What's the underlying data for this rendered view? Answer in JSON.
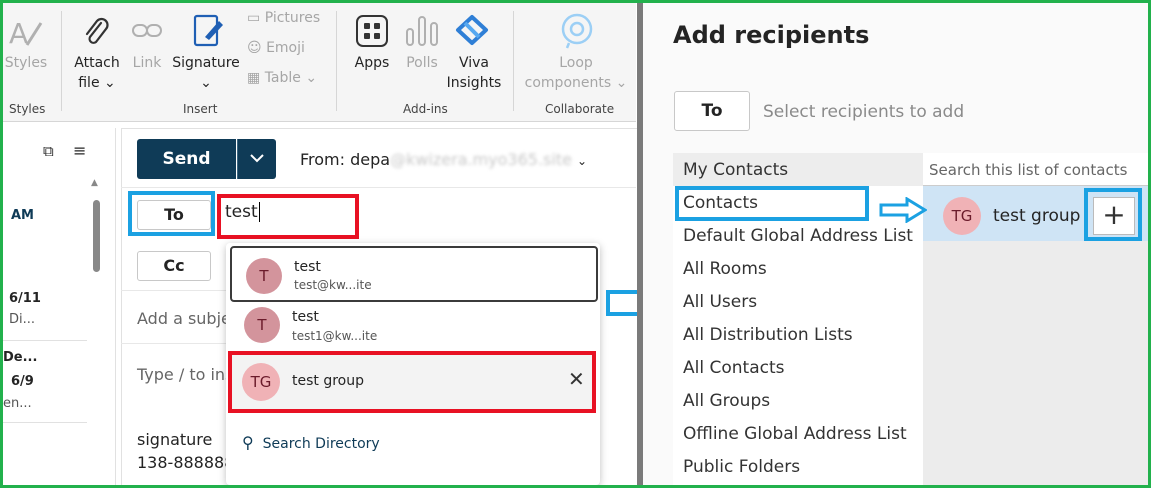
{
  "ribbon": {
    "styles": {
      "label": "Styles",
      "group": "Styles"
    },
    "insert": {
      "attach_file": "Attach file",
      "link": "Link",
      "signature": "Signature",
      "pictures": "Pictures",
      "emoji": "Emoji",
      "table": "Table",
      "group": "Insert"
    },
    "addins": {
      "apps": "Apps",
      "polls": "Polls",
      "viva": "Viva Insights",
      "group": "Add-ins"
    },
    "collaborate": {
      "loop": "Loop components",
      "group": "Collaborate"
    }
  },
  "message_list": {
    "items": [
      {
        "time": "AM"
      },
      {
        "date": "6/11",
        "preview": "Di..."
      },
      {
        "sender": "De...",
        "date": "6/9",
        "preview": "en..."
      }
    ]
  },
  "compose": {
    "send_label": "Send",
    "from_label": "From: depa",
    "from_address": "@kwizera.myo365.site",
    "to_label": "To",
    "to_value": "test",
    "cc_label": "Cc",
    "subject_placeholder": "Add a subje",
    "body_placeholder": "Type / to ins",
    "signature_line1": "signature",
    "signature_line2": "138-888888"
  },
  "suggestions": {
    "items": [
      {
        "initial": "T",
        "name": "test",
        "email": "test@kw...ite"
      },
      {
        "initial": "T",
        "name": "test",
        "email": "test1@kw...ite"
      },
      {
        "initial": "TG",
        "name": "test group",
        "email": ""
      }
    ],
    "search_directory": "Search Directory"
  },
  "dialog": {
    "title": "Add recipients",
    "to_label": "To",
    "to_placeholder": "Select recipients to add",
    "directories": [
      "My Contacts",
      "Contacts",
      "Default Global Address List",
      "All Rooms",
      "All Users",
      "All Distribution Lists",
      "All Contacts",
      "All Groups",
      "Offline Global Address List",
      "Public Folders"
    ],
    "search_placeholder": "Search this list of contacts",
    "result": {
      "initials": "TG",
      "name": "test group",
      "add": "+"
    }
  },
  "colors": {
    "frame": "#22b14c",
    "highlight_blue": "#1ba1e2",
    "highlight_red": "#e81123",
    "send": "#0f3b57",
    "avatar": "#d3949c",
    "avatar_group": "#f0b2b6"
  }
}
